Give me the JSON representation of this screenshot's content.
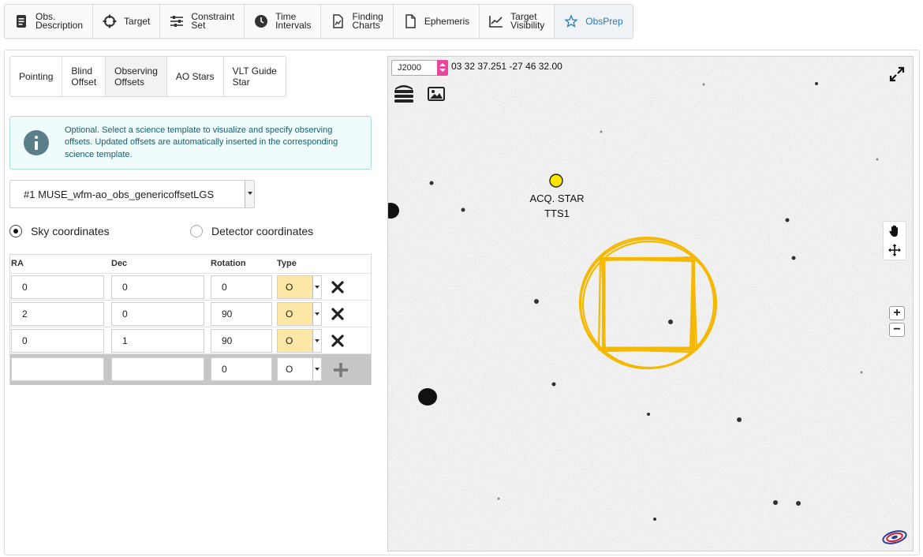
{
  "top_tabs": [
    {
      "label": "Obs.\nDescription",
      "icon": "document-icon"
    },
    {
      "label": "Target",
      "icon": "crosshair-icon"
    },
    {
      "label": "Constraint\nSet",
      "icon": "sliders-icon"
    },
    {
      "label": "Time\nIntervals",
      "icon": "clock-icon"
    },
    {
      "label": "Finding\nCharts",
      "icon": "chart-file-icon"
    },
    {
      "label": "Ephemeris",
      "icon": "file-icon"
    },
    {
      "label": "Target\nVisibility",
      "icon": "line-chart-icon"
    },
    {
      "label": "ObsPrep",
      "icon": "star-icon",
      "active": true
    }
  ],
  "sub_tabs": [
    {
      "label": "Pointing"
    },
    {
      "label": "Blind\nOffset"
    },
    {
      "label": "Observing\nOffsets",
      "active": true
    },
    {
      "label": "AO Stars"
    },
    {
      "label": "VLT Guide\nStar"
    }
  ],
  "info": {
    "text": "Optional. Select a science template to visualize and specify observing offsets. Updated offsets are automatically inserted in the corresponding science template."
  },
  "template_select": {
    "value": "#1 MUSE_wfm-ao_obs_genericoffsetLGS"
  },
  "coord_mode": {
    "sky_label": "Sky coordinates",
    "detector_label": "Detector coordinates",
    "selected": "sky"
  },
  "offsets": {
    "headers": {
      "ra": "RA",
      "dec": "Dec",
      "rotation": "Rotation",
      "type": "Type"
    },
    "rows": [
      {
        "ra": "0",
        "dec": "0",
        "rotation": "0",
        "type": "O"
      },
      {
        "ra": "2",
        "dec": "0",
        "rotation": "90",
        "type": "O"
      },
      {
        "ra": "0",
        "dec": "1",
        "rotation": "90",
        "type": "O"
      }
    ],
    "new_row": {
      "ra": "",
      "dec": "",
      "rotation": "0",
      "type": "O"
    }
  },
  "viewer": {
    "frame": "J2000",
    "coordinates": "03 32 37.251 -27 46 32.00",
    "acq_star_label": "ACQ. STAR",
    "acq_star_name": "TTS1",
    "footprint_color": "#f5b800",
    "acq_star_color": "#ffe600",
    "tools": [
      "pan-hand-icon",
      "move-icon"
    ],
    "zoom_in": "+",
    "zoom_out": "−"
  }
}
